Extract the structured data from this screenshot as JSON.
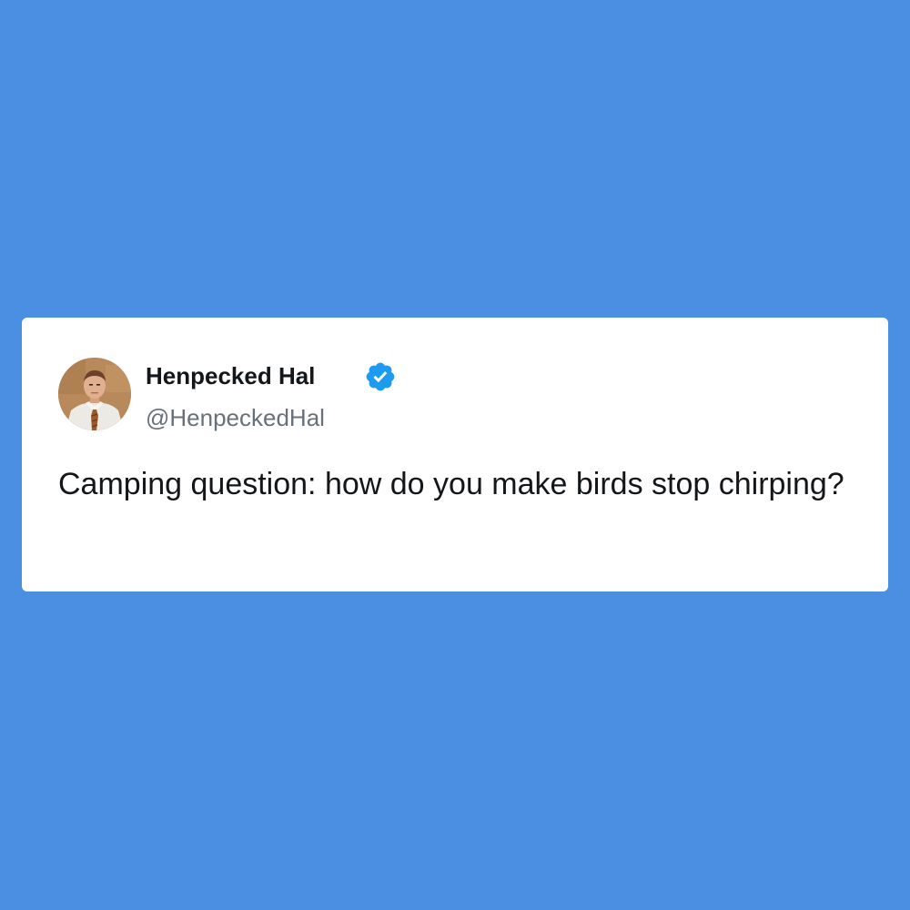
{
  "tweet": {
    "author": {
      "name": "Henpecked Hal",
      "handle": "@HenpeckedHal",
      "verified": true,
      "avatar_icon": "avatar-man-in-shirt-and-tie"
    },
    "text": "Camping question: how do you make birds stop chirping?"
  },
  "colors": {
    "background": "#4a8fe2",
    "card": "#ffffff",
    "verified_badge": "#1d9bf0",
    "text_primary": "#14171a",
    "text_secondary": "#687079"
  }
}
